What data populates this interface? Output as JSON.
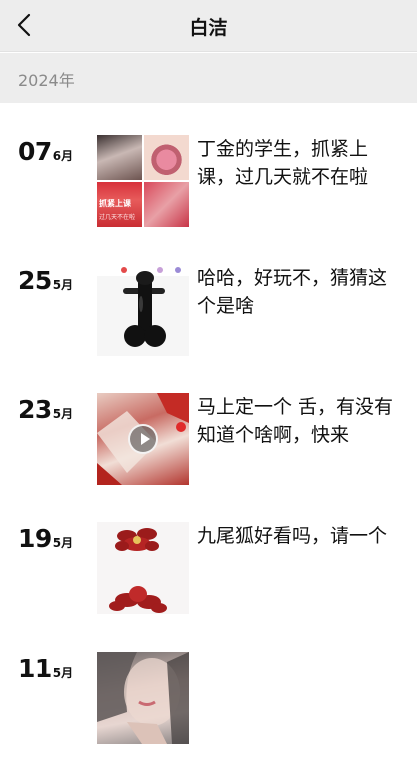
{
  "nav": {
    "title": "白洁"
  },
  "year": "2024年",
  "posts": [
    {
      "day": "07",
      "month": "6月",
      "caption": "丁金的学生，抓紧上课，过几天就不在啦",
      "thumb_text_1": "抓紧上课",
      "thumb_text_2": "过几天不在啦"
    },
    {
      "day": "25",
      "month": "5月",
      "caption": "哈哈，好玩不，猜猜这个是啥"
    },
    {
      "day": "23",
      "month": "5月",
      "caption": "马上定一个 舌，有没有知道个啥啊，快来"
    },
    {
      "day": "19",
      "month": "5月",
      "caption": "九尾狐好看吗，请一个"
    },
    {
      "day": "11",
      "month": "5月",
      "caption": ""
    }
  ]
}
